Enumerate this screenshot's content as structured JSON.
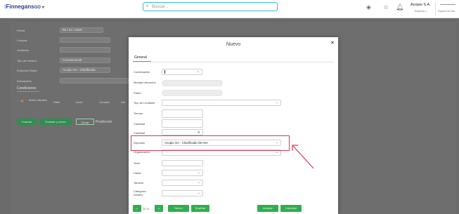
{
  "topbar": {
    "logo_text": "Finnegans",
    "logo_suffix": "GO",
    "search_placeholder": "Buscar...",
    "company_name": "Acopio S.A.",
    "company_sub": "Empresa ∨",
    "workspace": "Espacio de trab"
  },
  "background_form": {
    "labels": [
      "Fecha",
      "Compra",
      "Vendedor",
      "Tipo de Factura",
      "Empresa Origen",
      "Descripción"
    ],
    "fecha_value": "06 / 02 / 2020",
    "tipo_factura_value": "Convencional",
    "empresa_origen_value": "Acopio SA - Clasificado",
    "tab_label": "Condiciones",
    "columns": [
      "Modo Ubicado",
      "Hallo",
      "Inicio",
      "Cursado",
      "Ubi"
    ],
    "buttons": [
      "Guardar",
      "Guardar y nuevo",
      "Cerrar",
      "Predicción"
    ]
  },
  "modal": {
    "title": "Nuevo",
    "close": "×",
    "tab": "General",
    "fields": [
      {
        "label": "Combinación",
        "value": ""
      },
      {
        "label": "Medida Ubicación",
        "value": ""
      },
      {
        "label": "Padre",
        "value": ""
      },
      {
        "label": "Tipo de Limitante",
        "value": ""
      },
      {
        "label": "Tiempo",
        "value": ""
      },
      {
        "label": "Cantidad",
        "value": ""
      },
      {
        "label": "Cantidad",
        "value": "0"
      },
      {
        "label": "Depósito",
        "value": "Acopio SA - Clasificado 06 mm"
      },
      {
        "label": "Organización",
        "value": ""
      },
      {
        "label": "Serie",
        "value": ""
      },
      {
        "label": "Hasta",
        "value": ""
      },
      {
        "label": "Tamaño",
        "value": ""
      },
      {
        "label": "Categoría Destino",
        "value": ""
      }
    ],
    "pager": "0 / 0",
    "footer_buttons": [
      "Nuevo",
      "Duplicar",
      "Aceptar",
      "Cancelar"
    ]
  },
  "colors": {
    "accent": "#2fae4f",
    "highlight": "#d33a56",
    "search_border": "#39b8c7"
  }
}
